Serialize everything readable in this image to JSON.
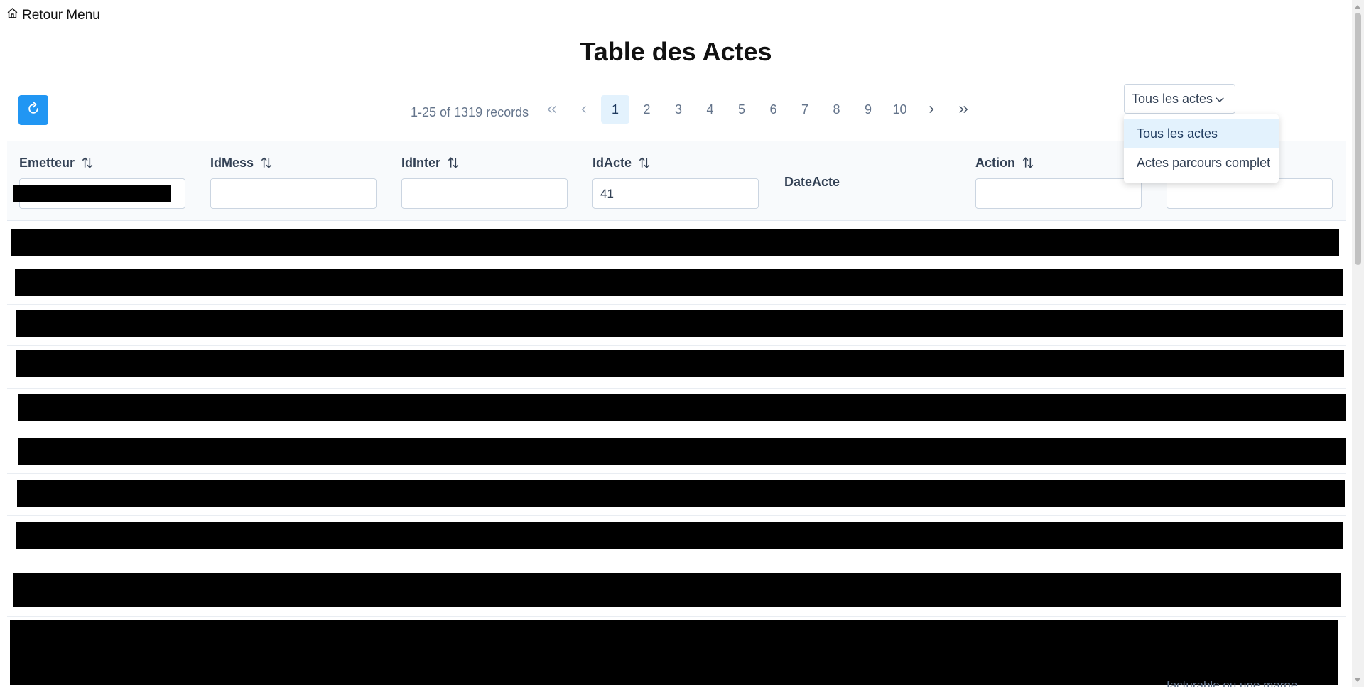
{
  "nav": {
    "back_label": "Retour Menu"
  },
  "page": {
    "title": "Table des Actes"
  },
  "toolbar": {
    "records": "1-25 of 1319 records"
  },
  "pagination": {
    "pages": [
      "1",
      "2",
      "3",
      "4",
      "5",
      "6",
      "7",
      "8",
      "9",
      "10"
    ],
    "current": "1"
  },
  "filter_select": {
    "selected": "Tous les actes",
    "options": [
      "Tous les actes",
      "Actes parcours complet"
    ]
  },
  "columns": [
    {
      "label": "Emetteur",
      "sortable": true,
      "filter_value": ""
    },
    {
      "label": "IdMess",
      "sortable": true,
      "filter_value": ""
    },
    {
      "label": "IdInter",
      "sortable": true,
      "filter_value": ""
    },
    {
      "label": "IdActe",
      "sortable": true,
      "filter_value": "41"
    },
    {
      "label": "DateActe",
      "sortable": false
    },
    {
      "label": "Action",
      "sortable": true,
      "filter_value": ""
    },
    {
      "label": "",
      "sortable": false,
      "filter_value": ""
    }
  ],
  "rows_redacted": 10,
  "bottom_partial_text": "facturable ou une marge",
  "colors": {
    "accent": "#2196f3",
    "selected_bg": "#e3f2fd",
    "header_bg": "#f8fafc"
  }
}
